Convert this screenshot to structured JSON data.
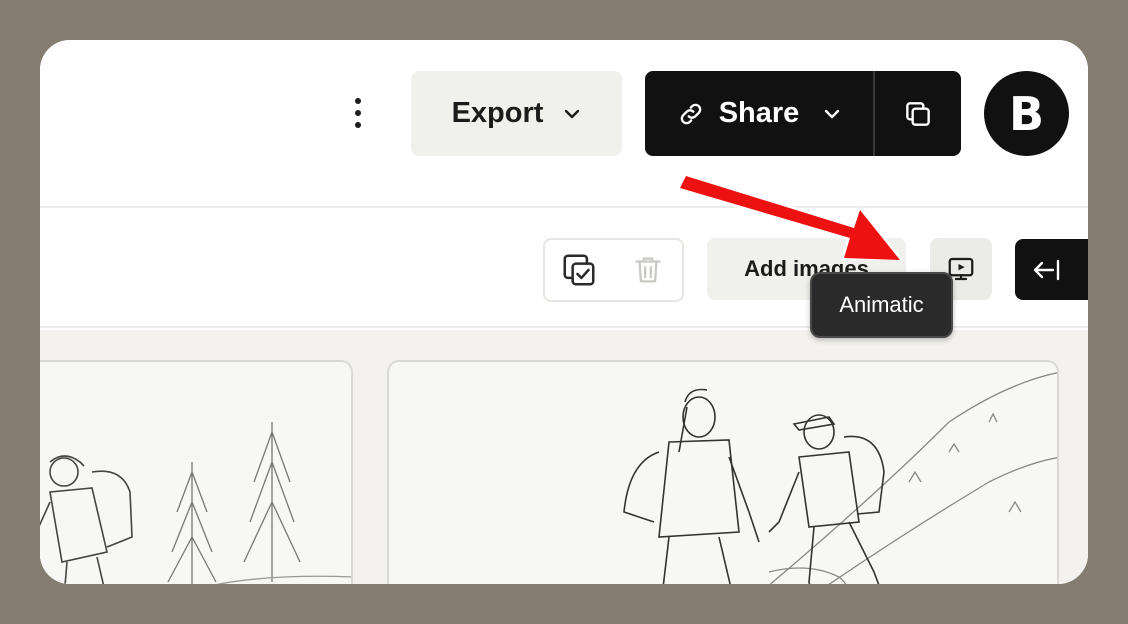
{
  "header": {
    "export_label": "Export",
    "share_label": "Share",
    "avatar_initial": "B"
  },
  "toolbar": {
    "add_images_label": "Add images",
    "animatic_tooltip": "Animatic"
  },
  "icons": {
    "more": "kebab-vertical-icon",
    "export_chevron": "chevron-down-icon",
    "share_link": "link-icon",
    "share_chevron": "chevron-down-icon",
    "copy": "copy-icon",
    "select_all": "copy-check-icon",
    "delete": "trash-icon",
    "animatic": "monitor-play-icon",
    "collapse": "arrow-left-to-line-icon"
  },
  "colors": {
    "frame": "#847e72",
    "primary_dark": "#111111",
    "secondary_bg": "#f0f0ec",
    "annotation_arrow": "#ee1111"
  },
  "storyboard": {
    "panels": [
      "hiker sketch panel",
      "two hikers climbing sketch panel"
    ]
  }
}
